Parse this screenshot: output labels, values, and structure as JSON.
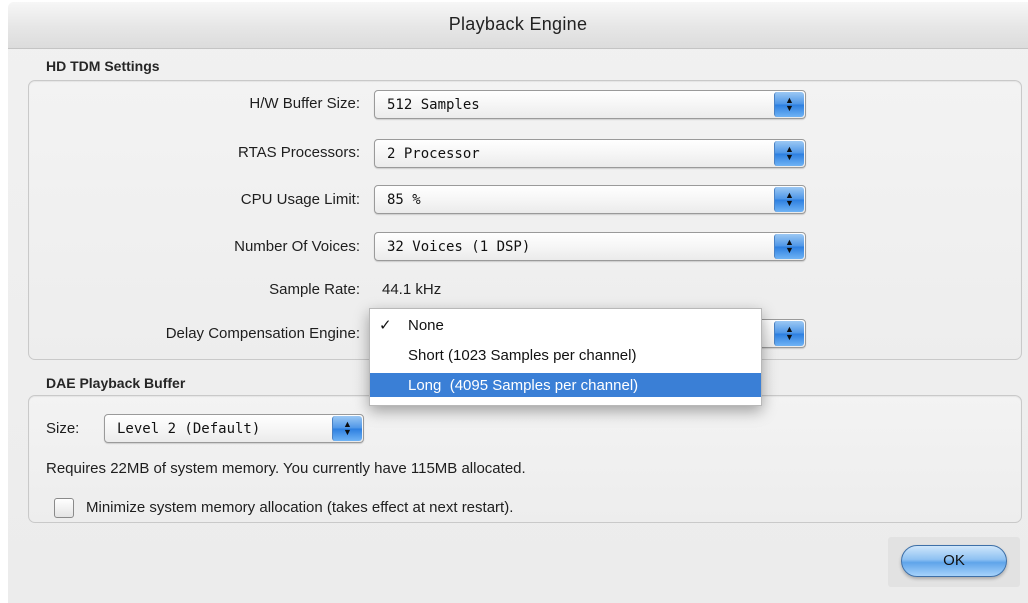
{
  "window": {
    "title": "Playback Engine"
  },
  "hd_tdm": {
    "section_label": "HD TDM Settings",
    "hw_buffer": {
      "label": "H/W Buffer Size:",
      "value": "512 Samples"
    },
    "rtas": {
      "label": "RTAS Processors:",
      "value": "2 Processor"
    },
    "cpu": {
      "label": "CPU Usage Limit:",
      "value": "85 %"
    },
    "voices": {
      "label": "Number Of Voices:",
      "value": "32 Voices (1 DSP)"
    },
    "sample_rate": {
      "label": "Sample Rate:",
      "value": "44.1 kHz"
    },
    "delay_comp": {
      "label": "Delay Compensation Engine:",
      "menu_items": [
        {
          "label": "None",
          "checked": true,
          "highlighted": false
        },
        {
          "label": "Short (1023 Samples per channel)",
          "checked": false,
          "highlighted": false
        },
        {
          "label": "Long  (4095 Samples per channel)",
          "checked": false,
          "highlighted": true
        }
      ],
      "check_glyph": "✓"
    }
  },
  "dae": {
    "section_label": "DAE Playback Buffer",
    "size_label": "Size:",
    "size_value": "Level 2 (Default)",
    "memory_text": "Requires 22MB of system memory. You currently have 115MB allocated.",
    "minimize_checkbox": {
      "label": "Minimize system memory allocation (takes effect at next restart).",
      "checked": false
    }
  },
  "buttons": {
    "ok": "OK"
  },
  "icons": {
    "popup_arrows": "popup-arrows-icon",
    "checkmark": "checkmark-icon"
  },
  "colors": {
    "highlight": "#3a7fd6",
    "aqua_button": "#5fa4ea"
  }
}
